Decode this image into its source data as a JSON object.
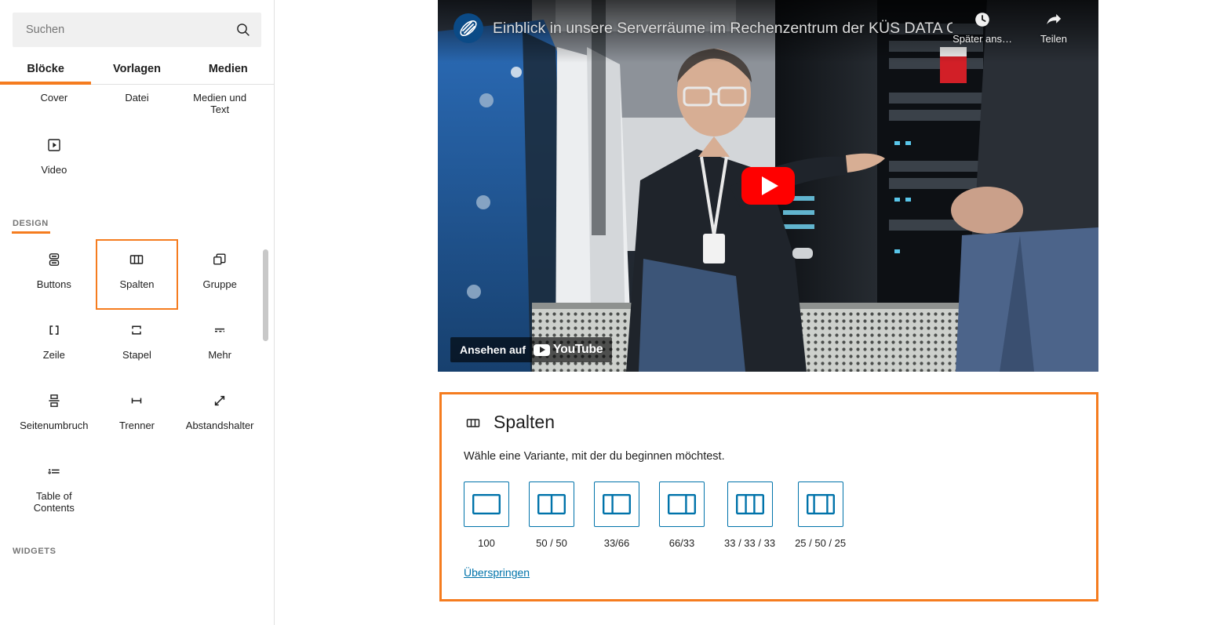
{
  "colors": {
    "highlight_orange": "#F57C1F",
    "wp_blue": "#0073AA",
    "youtube_red": "#FF0000"
  },
  "sidebar": {
    "search": {
      "placeholder": "Suchen",
      "value": "",
      "icon": "search-icon"
    },
    "tabs": [
      {
        "label": "Blöcke",
        "active": true
      },
      {
        "label": "Vorlagen",
        "active": false
      },
      {
        "label": "Medien",
        "active": false
      }
    ],
    "top_blocks": [
      {
        "label": "Cover",
        "icon": "cover-icon"
      },
      {
        "label": "Datei",
        "icon": "file-icon"
      },
      {
        "label": "Medien und Text",
        "icon": "media-text-icon"
      },
      {
        "label": "Video",
        "icon": "video-icon"
      }
    ],
    "sections": [
      {
        "label": "DESIGN",
        "highlighted": true,
        "blocks": [
          {
            "label": "Buttons",
            "icon": "buttons-icon",
            "selected": false
          },
          {
            "label": "Spalten",
            "icon": "columns-icon",
            "selected": true
          },
          {
            "label": "Gruppe",
            "icon": "group-icon",
            "selected": false
          },
          {
            "label": "Zeile",
            "icon": "row-icon",
            "selected": false
          },
          {
            "label": "Stapel",
            "icon": "stack-icon",
            "selected": false
          },
          {
            "label": "Mehr",
            "icon": "more-icon",
            "selected": false
          },
          {
            "label": "Seitenumbruch",
            "icon": "page-break-icon",
            "selected": false
          },
          {
            "label": "Trenner",
            "icon": "separator-icon",
            "selected": false
          },
          {
            "label": "Abstandshalter",
            "icon": "spacer-icon",
            "selected": false
          },
          {
            "label": "Table of Contents",
            "icon": "table-of-contents-icon",
            "selected": false
          }
        ]
      },
      {
        "label": "WIDGETS",
        "highlighted": false,
        "blocks": []
      }
    ]
  },
  "canvas": {
    "video": {
      "title": "Einblick in unsere Serverräume im Rechenzentrum der KÜS DATA GmbH",
      "avatar_name": "channel-avatar",
      "actions": [
        {
          "label": "Später ans…",
          "icon": "watch-later-clock-icon"
        },
        {
          "label": "Teilen",
          "icon": "share-arrow-icon"
        }
      ],
      "play_button": "play-button",
      "watch_on_label": "Ansehen auf",
      "watch_on_brand": "YouTube"
    },
    "columns_block": {
      "icon": "columns-icon",
      "title": "Spalten",
      "description": "Wähle eine Variante, mit der du beginnen möchtest.",
      "variations": [
        {
          "label": "100",
          "ratios": [
            100
          ]
        },
        {
          "label": "50 / 50",
          "ratios": [
            50,
            50
          ]
        },
        {
          "label": "33/66",
          "ratios": [
            33,
            66
          ]
        },
        {
          "label": "66/33",
          "ratios": [
            66,
            33
          ]
        },
        {
          "label": "33 / 33 / 33",
          "ratios": [
            33,
            33,
            33
          ]
        },
        {
          "label": "25 / 50 / 25",
          "ratios": [
            25,
            50,
            25
          ]
        }
      ],
      "skip_label": "Überspringen"
    }
  }
}
